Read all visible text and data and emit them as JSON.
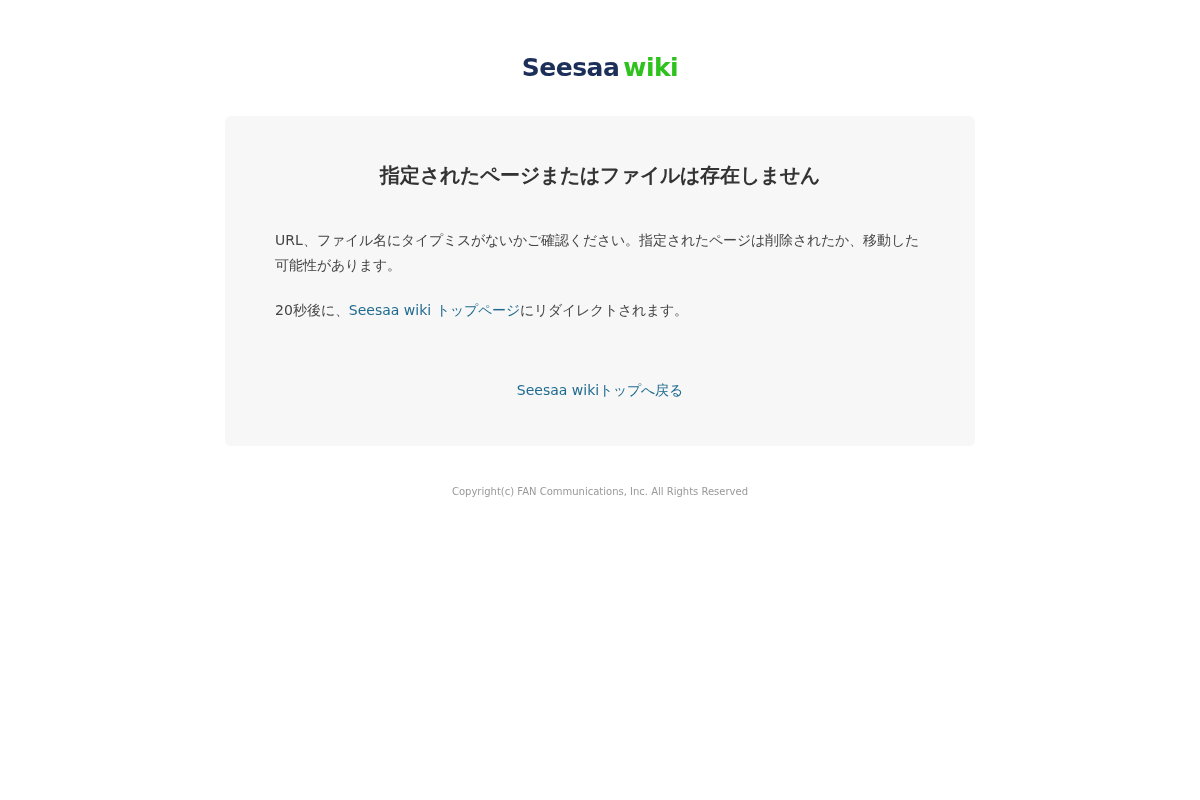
{
  "logo": {
    "brand": "Seesaa",
    "product": "wiki"
  },
  "card": {
    "title": "指定されたページまたはファイルは存在しません",
    "message": "URL、ファイル名にタイプミスがないかご確認ください。指定されたページは削除されたか、移動した可能性があります。",
    "redirect": {
      "before": "20秒後に、",
      "link": "Seesaa wiki トップページ",
      "after": "にリダイレクトされます。"
    },
    "back_link": "Seesaa wikiトップへ戻る"
  },
  "footer": "Copyright(c) FAN Communications, Inc. All Rights Reserved"
}
